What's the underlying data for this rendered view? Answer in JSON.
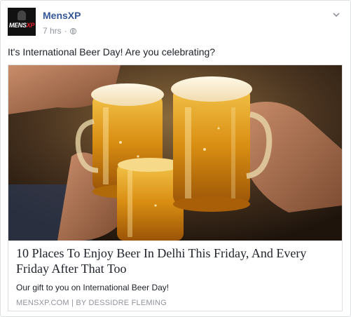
{
  "post": {
    "page_name": "MensXP",
    "avatar_text_main": "MENS",
    "avatar_text_accent": "XP",
    "timestamp": "7 hrs",
    "separator": "·",
    "message": "It's International Beer Day! Are you celebrating?",
    "icons": {
      "privacy": "globe-icon",
      "options": "chevron-down-icon"
    }
  },
  "link_preview": {
    "image_subject": "beer-mugs-toast",
    "title": "10 Places To Enjoy Beer In Delhi This Friday, And Every Friday After That Too",
    "description": "Our gift to you on International Beer Day!",
    "source": "MENSXP.COM",
    "source_separator": "|",
    "author": "BY DESSIDRE FLEMING"
  },
  "colors": {
    "page_name": "#365899",
    "meta": "#90949c",
    "text": "#1d2129",
    "border": "#dddfe2",
    "brand_accent": "#e41e26"
  }
}
